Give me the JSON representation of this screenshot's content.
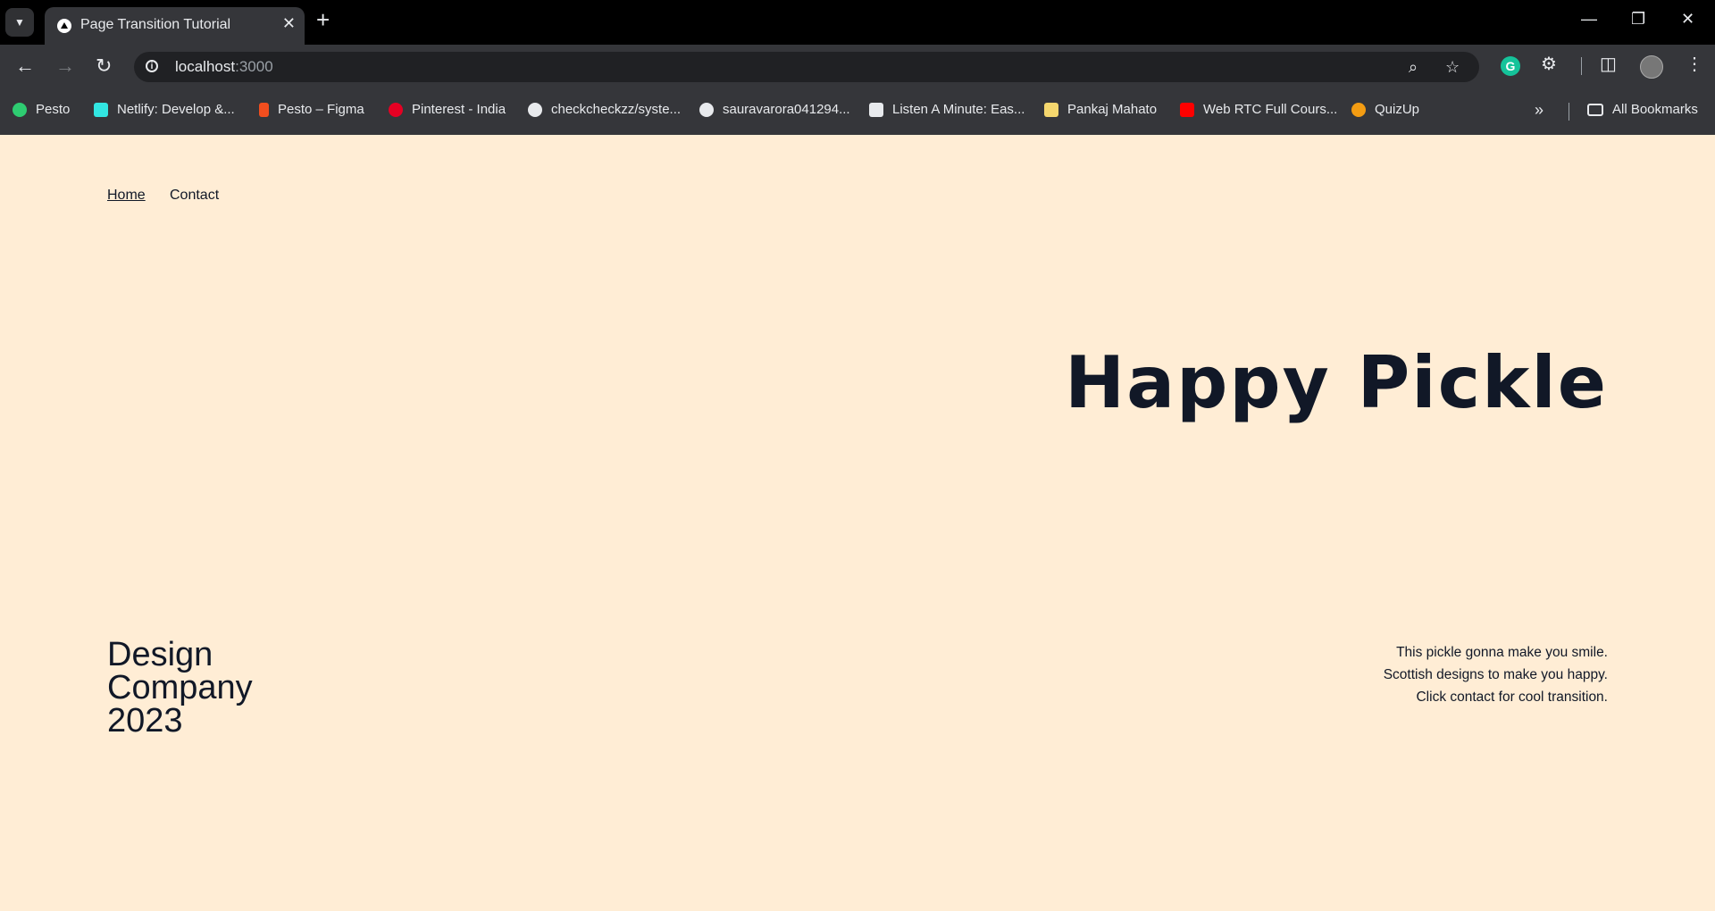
{
  "browser": {
    "tab_title": "Page Transition Tutorial",
    "url_host": "localhost",
    "url_port": ":3000",
    "bookmarks": [
      {
        "label": "Pesto",
        "color": "#2ecc71"
      },
      {
        "label": "Netlify: Develop &...",
        "color": "#32e6e2"
      },
      {
        "label": "Pesto – Figma",
        "color": "#f24e1e"
      },
      {
        "label": "Pinterest - India",
        "color": "#e60023"
      },
      {
        "label": "checkcheckzz/syste...",
        "color": "#e8eaed"
      },
      {
        "label": "sauravarora041294...",
        "color": "#e8eaed"
      },
      {
        "label": "Listen A Minute: Eas...",
        "color": "#e8eaed"
      },
      {
        "label": "Pankaj Mahato",
        "color": "#f5d76e"
      },
      {
        "label": "Web RTC Full Cours...",
        "color": "#ff0000"
      },
      {
        "label": "QuizUp",
        "color": "#f39c12"
      }
    ],
    "all_bookmarks": "All Bookmarks"
  },
  "page": {
    "nav": {
      "home": "Home",
      "contact": "Contact"
    },
    "hero_title": "Happy Pickle",
    "company_lines": [
      "Design",
      "Company",
      "2023"
    ],
    "tagline_lines": [
      "This pickle gonna make you smile.",
      "Scottish designs to make you happy.",
      "Click contact for cool transition."
    ],
    "background_color": "#ffedd5",
    "text_color": "#111827"
  }
}
